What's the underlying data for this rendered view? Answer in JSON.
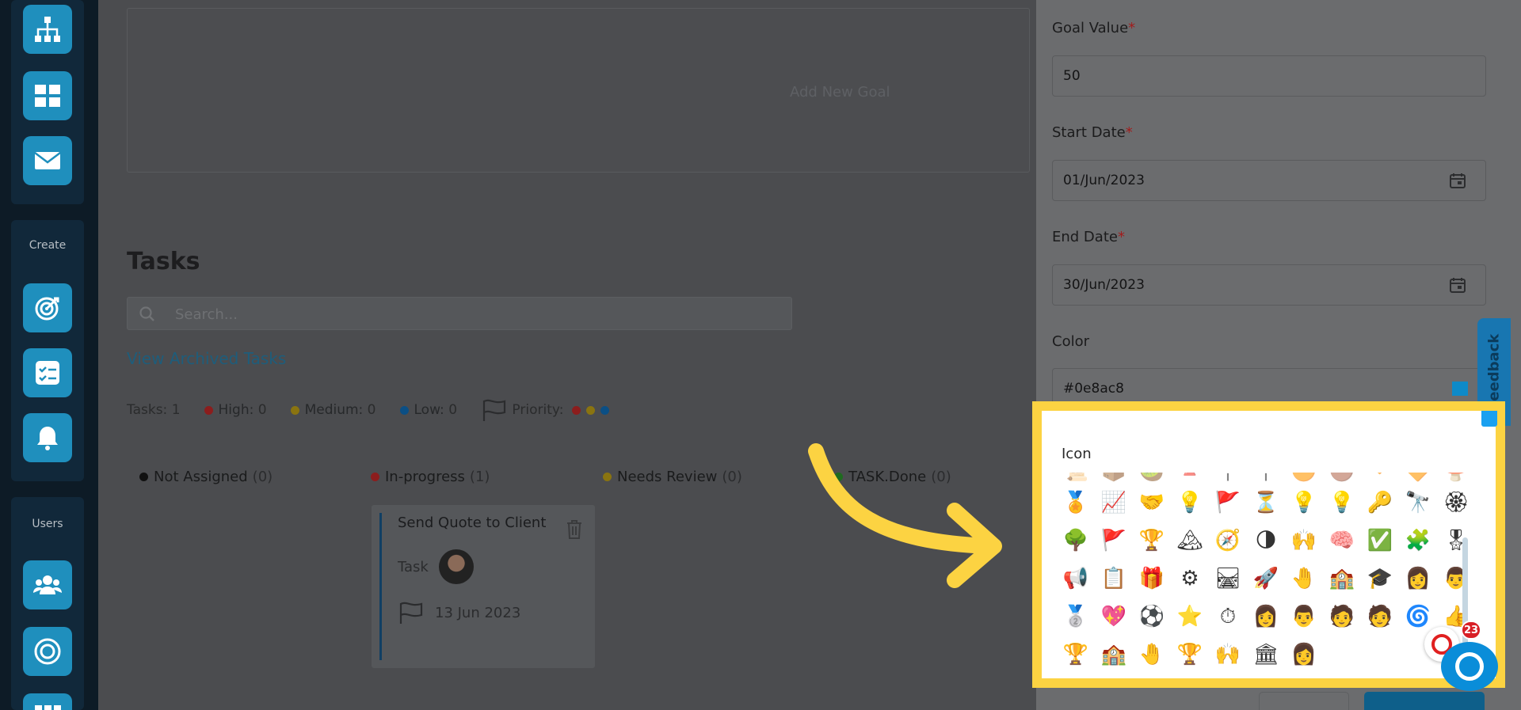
{
  "sidebar": {
    "create_label": "Create",
    "users_label": "Users",
    "icons": [
      "org-chart-icon",
      "dashboard-grid-icon",
      "mail-icon",
      "target-icon",
      "checklist-icon",
      "bell-icon",
      "users-icon",
      "target-circle-icon",
      "grid-icon"
    ]
  },
  "main": {
    "add_goal_label": "Add New Goal",
    "tasks_title": "Tasks",
    "search_placeholder": "Search...",
    "view_archived": "View Archived Tasks",
    "stats": {
      "tasks_label": "Tasks:",
      "tasks_value": "1",
      "high_label": "High:",
      "high_value": "0",
      "medium_label": "Medium:",
      "medium_value": "0",
      "low_label": "Low:",
      "low_value": "0",
      "priority_label": "Priority:"
    },
    "columns": [
      {
        "label": "Not Assigned",
        "count": "(0)",
        "color": "#111111"
      },
      {
        "label": "In-progress",
        "count": "(1)",
        "color": "#8c1d1d"
      },
      {
        "label": "Needs Review",
        "count": "(0)",
        "color": "#8a7410"
      },
      {
        "label": "TASK.Done",
        "count": "(0)",
        "color": "#1f6b1f"
      }
    ],
    "task": {
      "title": "Send Quote to Client",
      "type": "Task",
      "date": "13 Jun 2023"
    }
  },
  "panel": {
    "goal_value_label": "Goal Value",
    "goal_value": "50",
    "start_date_label": "Start Date",
    "start_date": "01/Jun/2023",
    "end_date_label": "End Date",
    "end_date": "30/Jun/2023",
    "color_label": "Color",
    "color_value": "#0e8ac8",
    "icon_label": "Icon",
    "feedback_label": "Feedback",
    "notification_count": "23",
    "icon_rows": [
      [
        "🏅",
        "📈",
        "🤝",
        "💡",
        "🚩",
        "⏳",
        "💡",
        "💡",
        "🔑",
        "🔭",
        "🏵"
      ],
      [
        "🌳",
        "🚩",
        "🏆",
        "🏔",
        "🧭",
        "🌗",
        "🙌",
        "🧠",
        "✅",
        "🧩",
        "🎖"
      ],
      [
        "📢",
        "📋",
        "🎁",
        "⚙",
        "🛤",
        "🚀",
        "🤚",
        "🏫",
        "🎓",
        "👩",
        "👨"
      ],
      [
        "🥈",
        "💖",
        "⚽",
        "⭐",
        "⏱",
        "👩",
        "👨",
        "🧑",
        "🧑",
        "🌀",
        "👍"
      ],
      [
        "🏆",
        "🏫",
        "🤚",
        "🏆",
        "🙌",
        "🏛",
        "👩"
      ]
    ]
  },
  "colors": {
    "accent": "#1f8fbd",
    "highlight": "#fcd342",
    "high": "#8c1d1d",
    "medium": "#8a7410",
    "low": "#0b4f85"
  }
}
